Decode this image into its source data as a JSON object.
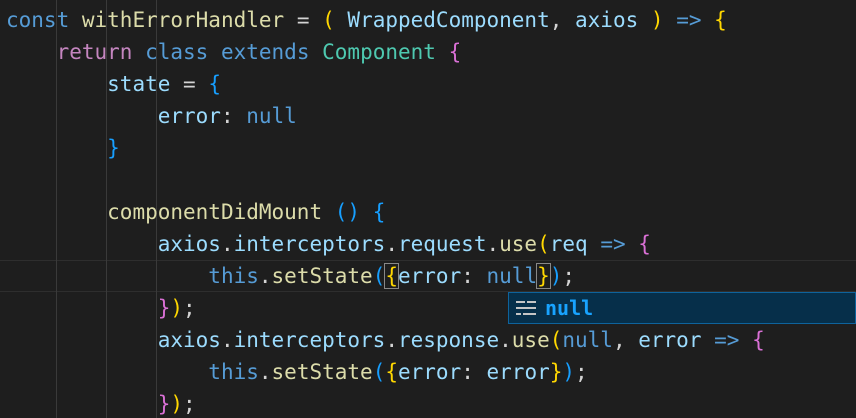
{
  "editor": {
    "lines": [
      {
        "segments": [
          {
            "t": "const",
            "c": "kw-blue"
          },
          {
            "t": " ",
            "c": "plain"
          },
          {
            "t": "withErrorHandler",
            "c": "fn"
          },
          {
            "t": " = ",
            "c": "plain"
          },
          {
            "t": "(",
            "c": "paren-yellow"
          },
          {
            "t": " ",
            "c": "plain"
          },
          {
            "t": "WrappedComponent",
            "c": "var"
          },
          {
            "t": ", ",
            "c": "plain"
          },
          {
            "t": "axios",
            "c": "var"
          },
          {
            "t": " ",
            "c": "plain"
          },
          {
            "t": ")",
            "c": "paren-yellow"
          },
          {
            "t": " ",
            "c": "plain"
          },
          {
            "t": "=>",
            "c": "kw-blue"
          },
          {
            "t": " ",
            "c": "plain"
          },
          {
            "t": "{",
            "c": "paren-yellow"
          }
        ]
      },
      {
        "segments": [
          {
            "t": "    ",
            "c": "plain"
          },
          {
            "t": "return",
            "c": "kw-purple"
          },
          {
            "t": " ",
            "c": "plain"
          },
          {
            "t": "class",
            "c": "kw-blue"
          },
          {
            "t": " ",
            "c": "plain"
          },
          {
            "t": "extends",
            "c": "kw-blue"
          },
          {
            "t": " ",
            "c": "plain"
          },
          {
            "t": "Component",
            "c": "type"
          },
          {
            "t": " ",
            "c": "plain"
          },
          {
            "t": "{",
            "c": "paren-purple"
          }
        ]
      },
      {
        "segments": [
          {
            "t": "        ",
            "c": "plain"
          },
          {
            "t": "state",
            "c": "var"
          },
          {
            "t": " = ",
            "c": "plain"
          },
          {
            "t": "{",
            "c": "paren-blue"
          }
        ]
      },
      {
        "segments": [
          {
            "t": "            ",
            "c": "plain"
          },
          {
            "t": "error",
            "c": "var"
          },
          {
            "t": ": ",
            "c": "plain"
          },
          {
            "t": "null",
            "c": "kw-blue"
          }
        ]
      },
      {
        "segments": [
          {
            "t": "        ",
            "c": "plain"
          },
          {
            "t": "}",
            "c": "paren-blue"
          }
        ]
      },
      {
        "segments": []
      },
      {
        "segments": [
          {
            "t": "        ",
            "c": "plain"
          },
          {
            "t": "componentDidMount",
            "c": "fn"
          },
          {
            "t": " ",
            "c": "plain"
          },
          {
            "t": "()",
            "c": "paren-blue"
          },
          {
            "t": " ",
            "c": "plain"
          },
          {
            "t": "{",
            "c": "paren-blue"
          }
        ]
      },
      {
        "segments": [
          {
            "t": "            ",
            "c": "plain"
          },
          {
            "t": "axios",
            "c": "var"
          },
          {
            "t": ".",
            "c": "plain"
          },
          {
            "t": "interceptors",
            "c": "var"
          },
          {
            "t": ".",
            "c": "plain"
          },
          {
            "t": "request",
            "c": "var"
          },
          {
            "t": ".",
            "c": "plain"
          },
          {
            "t": "use",
            "c": "fn"
          },
          {
            "t": "(",
            "c": "paren-yellow"
          },
          {
            "t": "req",
            "c": "var"
          },
          {
            "t": " ",
            "c": "plain"
          },
          {
            "t": "=>",
            "c": "kw-blue"
          },
          {
            "t": " ",
            "c": "plain"
          },
          {
            "t": "{",
            "c": "paren-purple"
          }
        ]
      },
      {
        "segments": [
          {
            "t": "                ",
            "c": "plain"
          },
          {
            "t": "this",
            "c": "kw-blue"
          },
          {
            "t": ".",
            "c": "plain"
          },
          {
            "t": "setState",
            "c": "fn"
          },
          {
            "t": "(",
            "c": "paren-blue"
          },
          {
            "t": "{",
            "c": "paren-yellow",
            "match": true
          },
          {
            "t": "error",
            "c": "var"
          },
          {
            "t": ": ",
            "c": "plain"
          },
          {
            "t": "null",
            "c": "kw-blue"
          },
          {
            "t": "}",
            "c": "paren-yellow",
            "match": true
          },
          {
            "t": ")",
            "c": "paren-blue"
          },
          {
            "t": ";",
            "c": "plain"
          }
        ]
      },
      {
        "segments": [
          {
            "t": "            ",
            "c": "plain"
          },
          {
            "t": "}",
            "c": "paren-purple"
          },
          {
            "t": ")",
            "c": "paren-yellow"
          },
          {
            "t": ";",
            "c": "plain"
          }
        ]
      },
      {
        "segments": [
          {
            "t": "            ",
            "c": "plain"
          },
          {
            "t": "axios",
            "c": "var"
          },
          {
            "t": ".",
            "c": "plain"
          },
          {
            "t": "interceptors",
            "c": "var"
          },
          {
            "t": ".",
            "c": "plain"
          },
          {
            "t": "response",
            "c": "var"
          },
          {
            "t": ".",
            "c": "plain"
          },
          {
            "t": "use",
            "c": "fn"
          },
          {
            "t": "(",
            "c": "paren-yellow"
          },
          {
            "t": "null",
            "c": "kw-blue"
          },
          {
            "t": ", ",
            "c": "plain"
          },
          {
            "t": "error",
            "c": "var"
          },
          {
            "t": " ",
            "c": "plain"
          },
          {
            "t": "=>",
            "c": "kw-blue"
          },
          {
            "t": " ",
            "c": "plain"
          },
          {
            "t": "{",
            "c": "paren-purple"
          }
        ]
      },
      {
        "segments": [
          {
            "t": "                ",
            "c": "plain"
          },
          {
            "t": "this",
            "c": "kw-blue"
          },
          {
            "t": ".",
            "c": "plain"
          },
          {
            "t": "setState",
            "c": "fn"
          },
          {
            "t": "(",
            "c": "paren-blue"
          },
          {
            "t": "{",
            "c": "paren-yellow"
          },
          {
            "t": "error",
            "c": "var"
          },
          {
            "t": ": ",
            "c": "plain"
          },
          {
            "t": "error",
            "c": "var"
          },
          {
            "t": "}",
            "c": "paren-yellow"
          },
          {
            "t": ")",
            "c": "paren-blue"
          },
          {
            "t": ";",
            "c": "plain"
          }
        ]
      },
      {
        "segments": [
          {
            "t": "            ",
            "c": "plain"
          },
          {
            "t": "}",
            "c": "paren-purple"
          },
          {
            "t": ")",
            "c": "paren-yellow"
          },
          {
            "t": ";",
            "c": "plain"
          }
        ]
      }
    ]
  },
  "suggest": {
    "label": "null",
    "icon": "keyword-icon"
  },
  "colors": {
    "background": "#1e1e1e",
    "keyword": "#569cd6",
    "control": "#c586c0",
    "type": "#4ec9b0",
    "variable": "#9cdcfe",
    "function": "#dcdcaa",
    "suggest_highlight": "#18a3ff"
  }
}
